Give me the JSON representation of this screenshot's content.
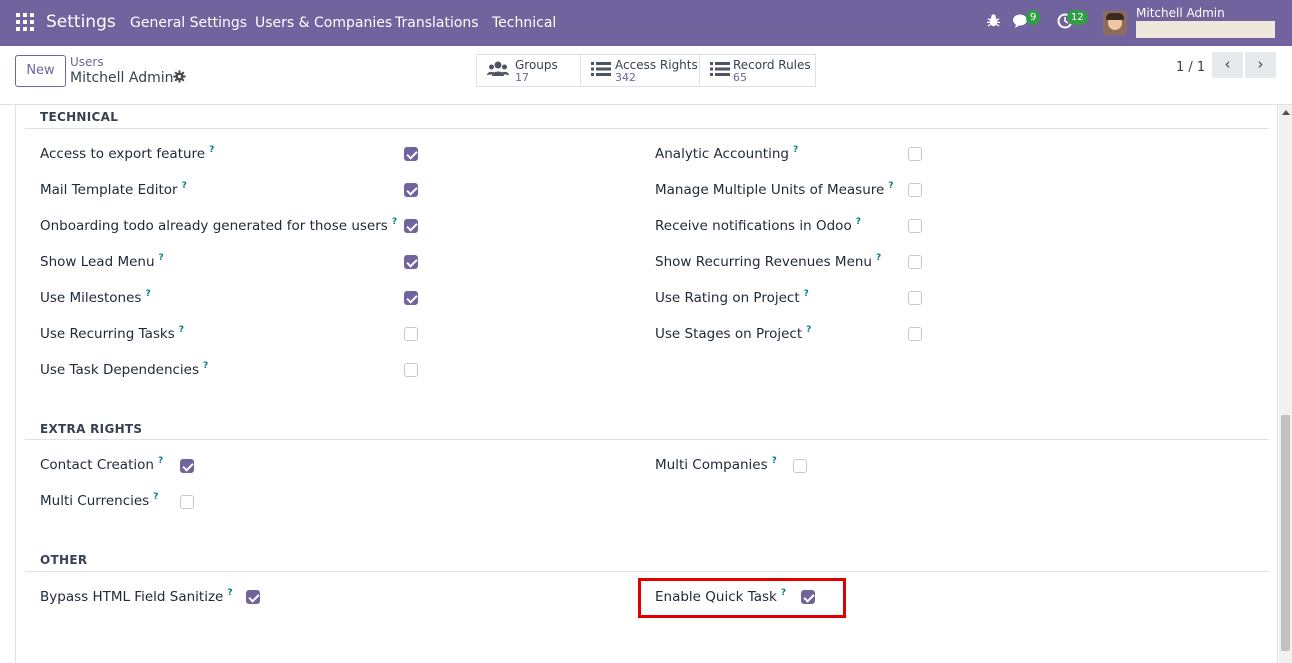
{
  "navbar": {
    "brand": "Settings",
    "menu": [
      "General Settings",
      "Users & Companies",
      "Translations",
      "Technical"
    ],
    "messages_badge": "9",
    "activities_badge": "12",
    "user_name": "Mitchell Admin"
  },
  "control_panel": {
    "new_label": "New",
    "breadcrumb_parent": "Users",
    "breadcrumb_current": "Mitchell Admin",
    "smart_buttons": [
      {
        "label": "Groups",
        "count": "17",
        "icon": "users-icon"
      },
      {
        "label": "Access Rights",
        "count": "342",
        "icon": "list-icon"
      },
      {
        "label": "Record Rules",
        "count": "65",
        "icon": "list-icon"
      }
    ],
    "pager": "1 / 1"
  },
  "sections": {
    "technical": {
      "title": "TECHNICAL",
      "left": [
        {
          "label": "Access to export feature",
          "checked": true
        },
        {
          "label": "Mail Template Editor",
          "checked": true
        },
        {
          "label": "Onboarding todo already generated for those users",
          "checked": true
        },
        {
          "label": "Show Lead Menu",
          "checked": true
        },
        {
          "label": "Use Milestones",
          "checked": true
        },
        {
          "label": "Use Recurring Tasks",
          "checked": false
        },
        {
          "label": "Use Task Dependencies",
          "checked": false
        }
      ],
      "right": [
        {
          "label": "Analytic Accounting",
          "checked": false
        },
        {
          "label": "Manage Multiple Units of Measure",
          "checked": false
        },
        {
          "label": "Receive notifications in Odoo",
          "checked": false
        },
        {
          "label": "Show Recurring Revenues Menu",
          "checked": false
        },
        {
          "label": "Use Rating on Project",
          "checked": false
        },
        {
          "label": "Use Stages on Project",
          "checked": false
        }
      ]
    },
    "extra_rights": {
      "title": "EXTRA RIGHTS",
      "left": [
        {
          "label": "Contact Creation",
          "checked": true
        },
        {
          "label": "Multi Currencies",
          "checked": false
        }
      ],
      "right": [
        {
          "label": "Multi Companies",
          "checked": false
        }
      ]
    },
    "other": {
      "title": "OTHER",
      "left": [
        {
          "label": "Bypass HTML Field Sanitize",
          "checked": true
        }
      ],
      "right": [
        {
          "label": "Enable Quick Task",
          "checked": true
        }
      ]
    }
  },
  "help_marker": "?",
  "colors": {
    "primary": "#71639e",
    "highlight": "#e00000",
    "badge": "#2f9e44"
  }
}
